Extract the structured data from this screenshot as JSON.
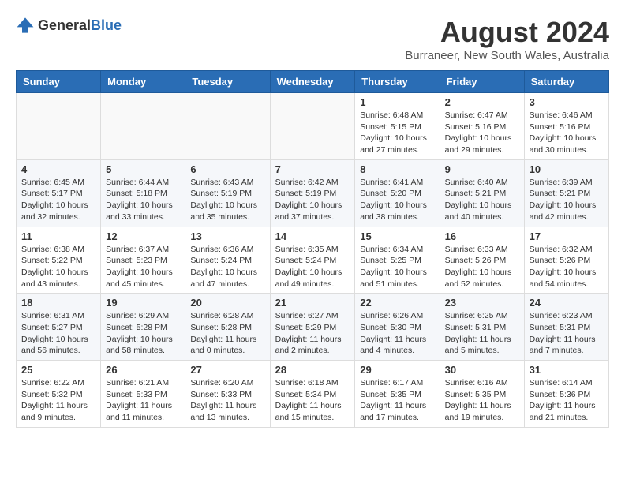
{
  "header": {
    "logo_general": "General",
    "logo_blue": "Blue",
    "month_year": "August 2024",
    "location": "Burraneer, New South Wales, Australia"
  },
  "weekdays": [
    "Sunday",
    "Monday",
    "Tuesday",
    "Wednesday",
    "Thursday",
    "Friday",
    "Saturday"
  ],
  "weeks": [
    [
      {
        "day": "",
        "info": ""
      },
      {
        "day": "",
        "info": ""
      },
      {
        "day": "",
        "info": ""
      },
      {
        "day": "",
        "info": ""
      },
      {
        "day": "1",
        "info": "Sunrise: 6:48 AM\nSunset: 5:15 PM\nDaylight: 10 hours and 27 minutes."
      },
      {
        "day": "2",
        "info": "Sunrise: 6:47 AM\nSunset: 5:16 PM\nDaylight: 10 hours and 29 minutes."
      },
      {
        "day": "3",
        "info": "Sunrise: 6:46 AM\nSunset: 5:16 PM\nDaylight: 10 hours and 30 minutes."
      }
    ],
    [
      {
        "day": "4",
        "info": "Sunrise: 6:45 AM\nSunset: 5:17 PM\nDaylight: 10 hours and 32 minutes."
      },
      {
        "day": "5",
        "info": "Sunrise: 6:44 AM\nSunset: 5:18 PM\nDaylight: 10 hours and 33 minutes."
      },
      {
        "day": "6",
        "info": "Sunrise: 6:43 AM\nSunset: 5:19 PM\nDaylight: 10 hours and 35 minutes."
      },
      {
        "day": "7",
        "info": "Sunrise: 6:42 AM\nSunset: 5:19 PM\nDaylight: 10 hours and 37 minutes."
      },
      {
        "day": "8",
        "info": "Sunrise: 6:41 AM\nSunset: 5:20 PM\nDaylight: 10 hours and 38 minutes."
      },
      {
        "day": "9",
        "info": "Sunrise: 6:40 AM\nSunset: 5:21 PM\nDaylight: 10 hours and 40 minutes."
      },
      {
        "day": "10",
        "info": "Sunrise: 6:39 AM\nSunset: 5:21 PM\nDaylight: 10 hours and 42 minutes."
      }
    ],
    [
      {
        "day": "11",
        "info": "Sunrise: 6:38 AM\nSunset: 5:22 PM\nDaylight: 10 hours and 43 minutes."
      },
      {
        "day": "12",
        "info": "Sunrise: 6:37 AM\nSunset: 5:23 PM\nDaylight: 10 hours and 45 minutes."
      },
      {
        "day": "13",
        "info": "Sunrise: 6:36 AM\nSunset: 5:24 PM\nDaylight: 10 hours and 47 minutes."
      },
      {
        "day": "14",
        "info": "Sunrise: 6:35 AM\nSunset: 5:24 PM\nDaylight: 10 hours and 49 minutes."
      },
      {
        "day": "15",
        "info": "Sunrise: 6:34 AM\nSunset: 5:25 PM\nDaylight: 10 hours and 51 minutes."
      },
      {
        "day": "16",
        "info": "Sunrise: 6:33 AM\nSunset: 5:26 PM\nDaylight: 10 hours and 52 minutes."
      },
      {
        "day": "17",
        "info": "Sunrise: 6:32 AM\nSunset: 5:26 PM\nDaylight: 10 hours and 54 minutes."
      }
    ],
    [
      {
        "day": "18",
        "info": "Sunrise: 6:31 AM\nSunset: 5:27 PM\nDaylight: 10 hours and 56 minutes."
      },
      {
        "day": "19",
        "info": "Sunrise: 6:29 AM\nSunset: 5:28 PM\nDaylight: 10 hours and 58 minutes."
      },
      {
        "day": "20",
        "info": "Sunrise: 6:28 AM\nSunset: 5:28 PM\nDaylight: 11 hours and 0 minutes."
      },
      {
        "day": "21",
        "info": "Sunrise: 6:27 AM\nSunset: 5:29 PM\nDaylight: 11 hours and 2 minutes."
      },
      {
        "day": "22",
        "info": "Sunrise: 6:26 AM\nSunset: 5:30 PM\nDaylight: 11 hours and 4 minutes."
      },
      {
        "day": "23",
        "info": "Sunrise: 6:25 AM\nSunset: 5:31 PM\nDaylight: 11 hours and 5 minutes."
      },
      {
        "day": "24",
        "info": "Sunrise: 6:23 AM\nSunset: 5:31 PM\nDaylight: 11 hours and 7 minutes."
      }
    ],
    [
      {
        "day": "25",
        "info": "Sunrise: 6:22 AM\nSunset: 5:32 PM\nDaylight: 11 hours and 9 minutes."
      },
      {
        "day": "26",
        "info": "Sunrise: 6:21 AM\nSunset: 5:33 PM\nDaylight: 11 hours and 11 minutes."
      },
      {
        "day": "27",
        "info": "Sunrise: 6:20 AM\nSunset: 5:33 PM\nDaylight: 11 hours and 13 minutes."
      },
      {
        "day": "28",
        "info": "Sunrise: 6:18 AM\nSunset: 5:34 PM\nDaylight: 11 hours and 15 minutes."
      },
      {
        "day": "29",
        "info": "Sunrise: 6:17 AM\nSunset: 5:35 PM\nDaylight: 11 hours and 17 minutes."
      },
      {
        "day": "30",
        "info": "Sunrise: 6:16 AM\nSunset: 5:35 PM\nDaylight: 11 hours and 19 minutes."
      },
      {
        "day": "31",
        "info": "Sunrise: 6:14 AM\nSunset: 5:36 PM\nDaylight: 11 hours and 21 minutes."
      }
    ]
  ]
}
